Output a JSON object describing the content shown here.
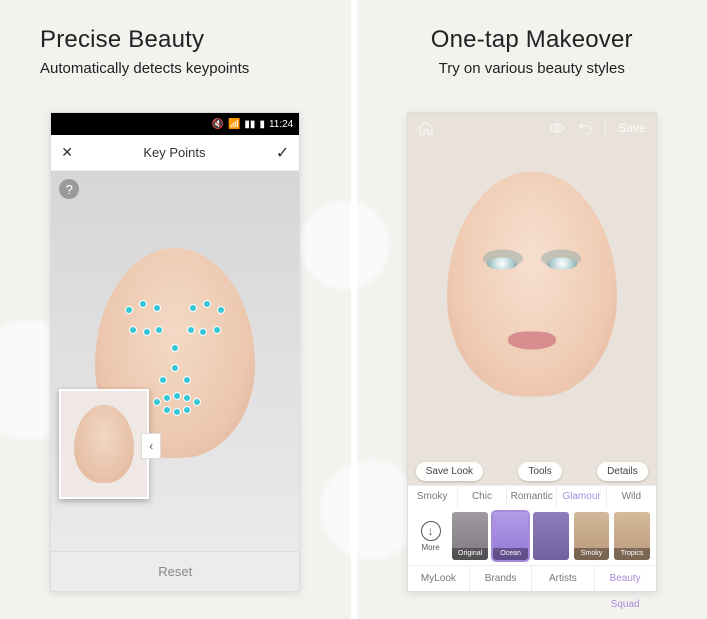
{
  "left": {
    "title": "Precise Beauty",
    "subtitle": "Automatically detects keypoints",
    "statusbar": {
      "time": "11:24"
    },
    "appbar": {
      "title": "Key Points"
    },
    "help": "?",
    "inset_chevron": "‹",
    "reset": "Reset"
  },
  "right": {
    "title": "One-tap Makeover",
    "subtitle": "Try on various beauty styles",
    "topbar": {
      "save": "Save"
    },
    "pills": {
      "save_look": "Save Look",
      "tools": "Tools",
      "details": "Details"
    },
    "styles": [
      "Smoky",
      "Chic",
      "Romantic",
      "Glamour",
      "Wild"
    ],
    "styles_selected": "Glamour",
    "more_label": "More",
    "thumbs": [
      {
        "key": "original",
        "label": "Original"
      },
      {
        "key": "ocean",
        "label": "Ocean"
      },
      {
        "key": "blank",
        "label": ""
      },
      {
        "key": "smoky",
        "label": "Smoky"
      },
      {
        "key": "tropics",
        "label": "Tropics"
      }
    ],
    "bottom_tabs": [
      "MyLook",
      "Brands",
      "Artists",
      "Beauty Squad"
    ],
    "bottom_selected": "Beauty Squad"
  }
}
